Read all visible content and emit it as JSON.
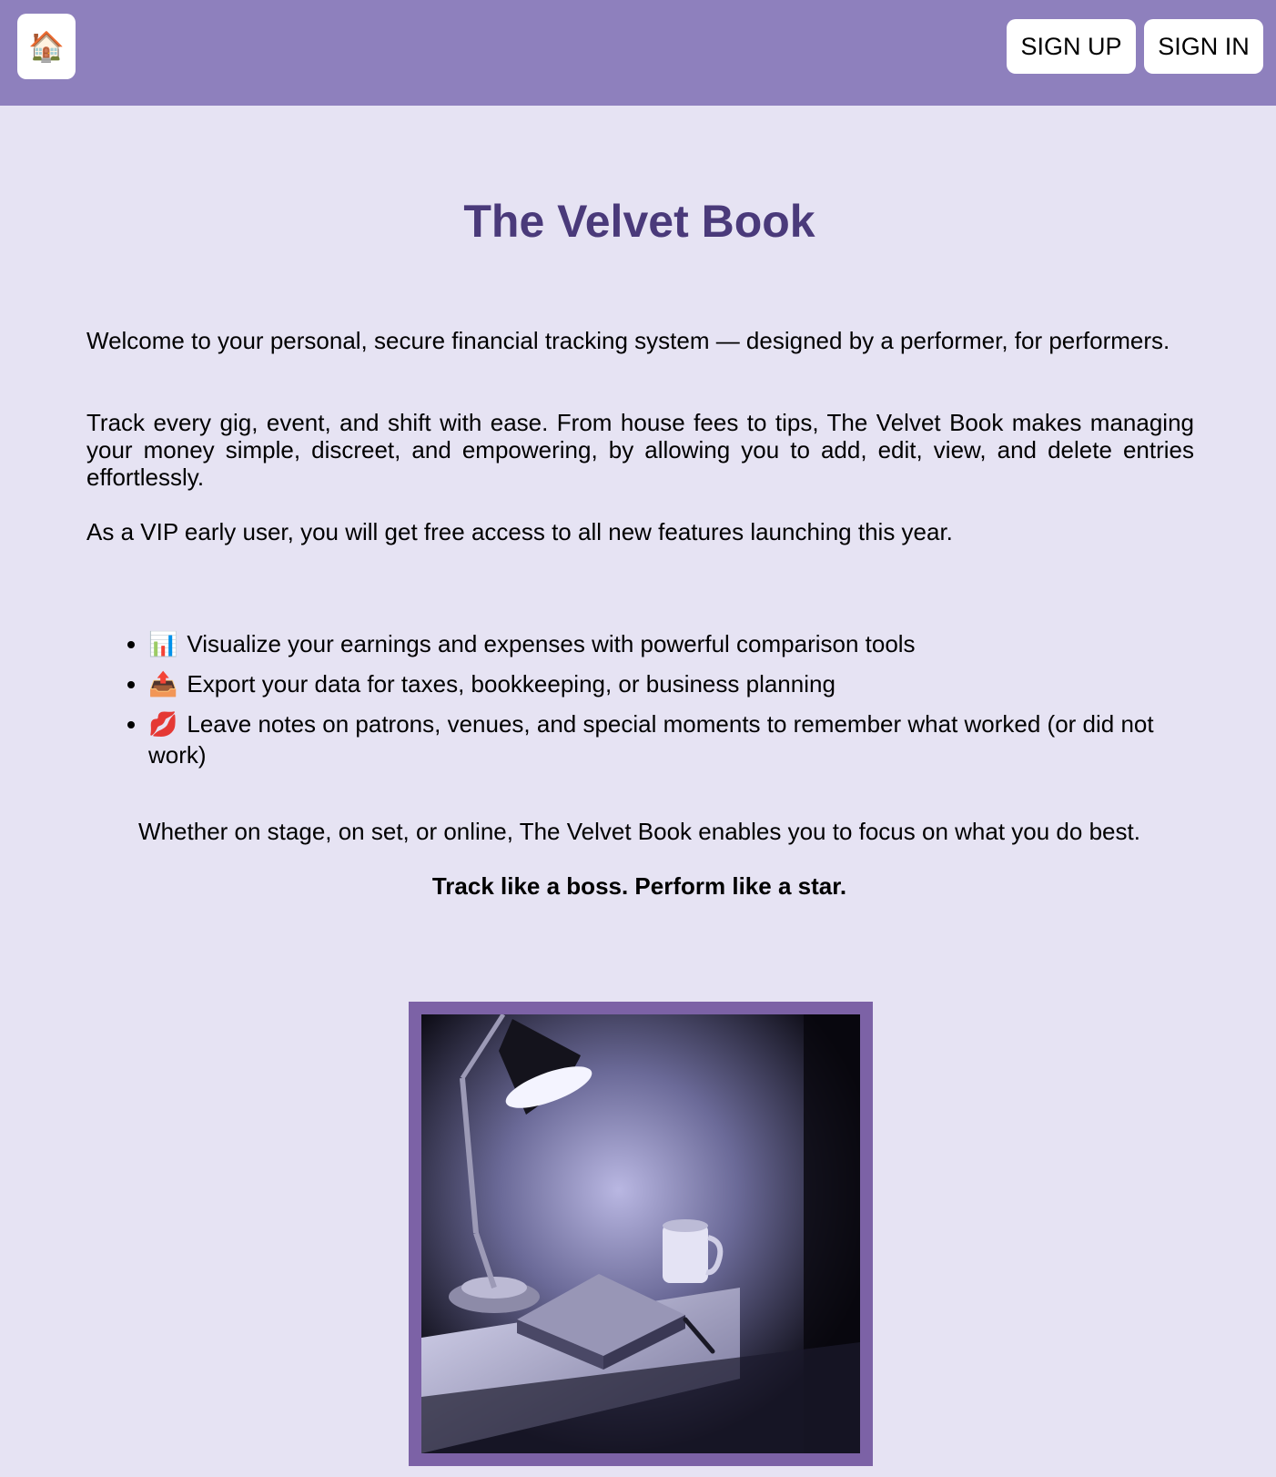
{
  "header": {
    "home_icon": "house-icon",
    "home_glyph": "🏠",
    "signup_label": "SIGN UP",
    "signin_label": "SIGN IN"
  },
  "main": {
    "title": "The Velvet Book",
    "paragraphs": [
      "Welcome to your personal, secure financial tracking system — designed by a performer, for performers.",
      "Track every gig, event, and shift with ease. From house fees to tips, The Velvet Book makes managing your money simple, discreet, and empowering, by allowing you to add, edit, view, and delete entries effortlessly.",
      "As a VIP early user, you will get free access to all new features launching this year."
    ],
    "features": [
      {
        "icon": "bar-chart-icon",
        "glyph": "📊",
        "text": "Visualize your earnings and expenses with powerful comparison tools"
      },
      {
        "icon": "outbox-tray-icon",
        "glyph": "📤",
        "text": "Export your data for taxes, bookkeeping, or business planning"
      },
      {
        "icon": "kiss-mark-icon",
        "glyph": "💋",
        "text": "Leave notes on patrons, venues, and special moments to remember what worked (or did not work)"
      }
    ],
    "closing": "Whether on stage, on set, or online, The Velvet Book enables you to focus on what you do best.",
    "tagline": "Track like a boss. Perform like a star."
  },
  "colors": {
    "header_bg": "#8e80bd",
    "page_bg": "#e6e3f3",
    "title": "#4a3a7a",
    "frame": "#7c62a6"
  }
}
